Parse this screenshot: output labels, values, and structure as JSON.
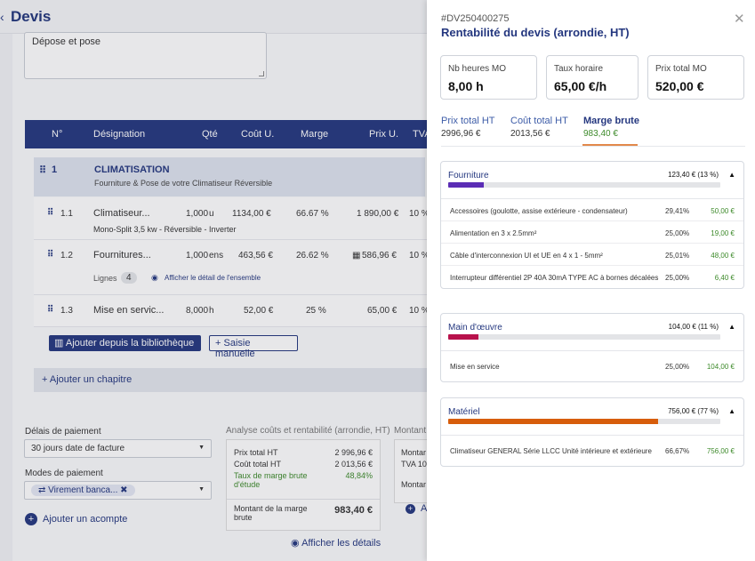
{
  "background": {
    "title": "Devis",
    "description_text": "Dépose et pose",
    "table": {
      "headers": [
        "N°",
        "Désignation",
        "Qté",
        "Coût U.",
        "Marge",
        "Prix U.",
        "TVA"
      ],
      "chapter": {
        "num": "1",
        "name": "CLIMATISATION",
        "sub": "Fourniture & Pose de votre Climatiseur Réversible"
      },
      "lines": [
        {
          "num": "1.1",
          "designation": "Climatiseur...",
          "qty": "1,000",
          "unit": "u",
          "cost": "1134,00 €",
          "margin": "66.67 %",
          "price": "1 890,00 €",
          "tva": "10 %",
          "sub": "Mono-Split 3,5 kw - Réversible - Inverter"
        },
        {
          "num": "1.2",
          "designation": "Fournitures...",
          "qty": "1,000",
          "unit": "ens",
          "cost": "463,56 €",
          "margin": "26.62 %",
          "price": "586,96 €",
          "tva": "10 %",
          "lignes_label": "Lignes",
          "lignes_count": "4",
          "detail_link": "Afficher le détail de l'ensemble"
        },
        {
          "num": "1.3",
          "designation": "Mise en servic...",
          "qty": "8,000",
          "unit": "h",
          "cost": "52,00 €",
          "margin": "25 %",
          "price": "65,00 €",
          "tva": "10 %"
        }
      ],
      "add_library": "Ajouter depuis la bibliothèque",
      "add_manual": "Saisie manuelle",
      "add_chapter": "Ajouter un chapitre"
    },
    "payment": {
      "delay_label": "Délais de paiement",
      "delay_value": "30 jours date de facture",
      "modes_label": "Modes de paiement",
      "mode_chip": "Virement banca...",
      "add_deposit": "Ajouter un acompte"
    },
    "analysis": {
      "title": "Analyse coûts et rentabilité (arrondie, HT)",
      "rows": [
        {
          "label": "Prix total HT",
          "value": "2 996,96 €"
        },
        {
          "label": "Coût total HT",
          "value": "2 013,56 €"
        },
        {
          "label": "Taux de marge brute d'étude",
          "value": "48,84%"
        }
      ],
      "margin_label": "Montant de la marge brute",
      "margin_value": "983,40 €",
      "details_link": "Afficher les détails"
    },
    "montant": {
      "title": "Montant",
      "l1": "Montar",
      "l2": "TVA 10'",
      "l3": "Montar",
      "l4": "Aj"
    }
  },
  "drawer": {
    "ref": "#DV250400275",
    "title": "Rentabilité du devis (arrondie, HT)",
    "close_icon": "close-icon",
    "kpis": [
      {
        "label": "Nb heures MO",
        "value": "8,00 h"
      },
      {
        "label": "Taux horaire",
        "value": "65,00 €/h"
      },
      {
        "label": "Prix total MO",
        "value": "520,00 €"
      }
    ],
    "tabs": [
      {
        "label": "Prix total HT",
        "value": "2996,96 €"
      },
      {
        "label": "Coût total HT",
        "value": "2013,56 €"
      },
      {
        "label": "Marge brute",
        "value": "983,40 €"
      }
    ],
    "active_tab": "Marge brute",
    "sections": [
      {
        "name": "Fourniture",
        "amount": "123,40 € (13 %)",
        "percent": 13,
        "color": "#5b2db5",
        "items": [
          {
            "name": "Accessoires (goulotte, assise extérieure - condensateur)",
            "pct": "29,41%",
            "margin": "50,00 €"
          },
          {
            "name": "Alimentation en 3 x 2.5mm²",
            "pct": "25,00%",
            "margin": "19,00 €"
          },
          {
            "name": "Câble d'interconnexion UI et UE en 4 x 1 - 5mm²",
            "pct": "25,01%",
            "margin": "48,00 €"
          },
          {
            "name": "Interrupteur différentiel 2P 40A 30mA TYPE AC à bornes décalées",
            "pct": "25,00%",
            "margin": "6,40 €"
          }
        ]
      },
      {
        "name": "Main d'œuvre",
        "amount": "104,00 € (11 %)",
        "percent": 11,
        "color": "#b8124c",
        "items": [
          {
            "name": "Mise en service",
            "pct": "25,00%",
            "margin": "104,00 €"
          }
        ]
      },
      {
        "name": "Matériel",
        "amount": "756,00 € (77 %)",
        "percent": 77,
        "color": "#d75d0b",
        "items": [
          {
            "name": "Climatiseur GENERAL Série LLCC Unité intérieure et extérieure",
            "pct": "66,67%",
            "margin": "756,00 €"
          }
        ]
      }
    ]
  }
}
